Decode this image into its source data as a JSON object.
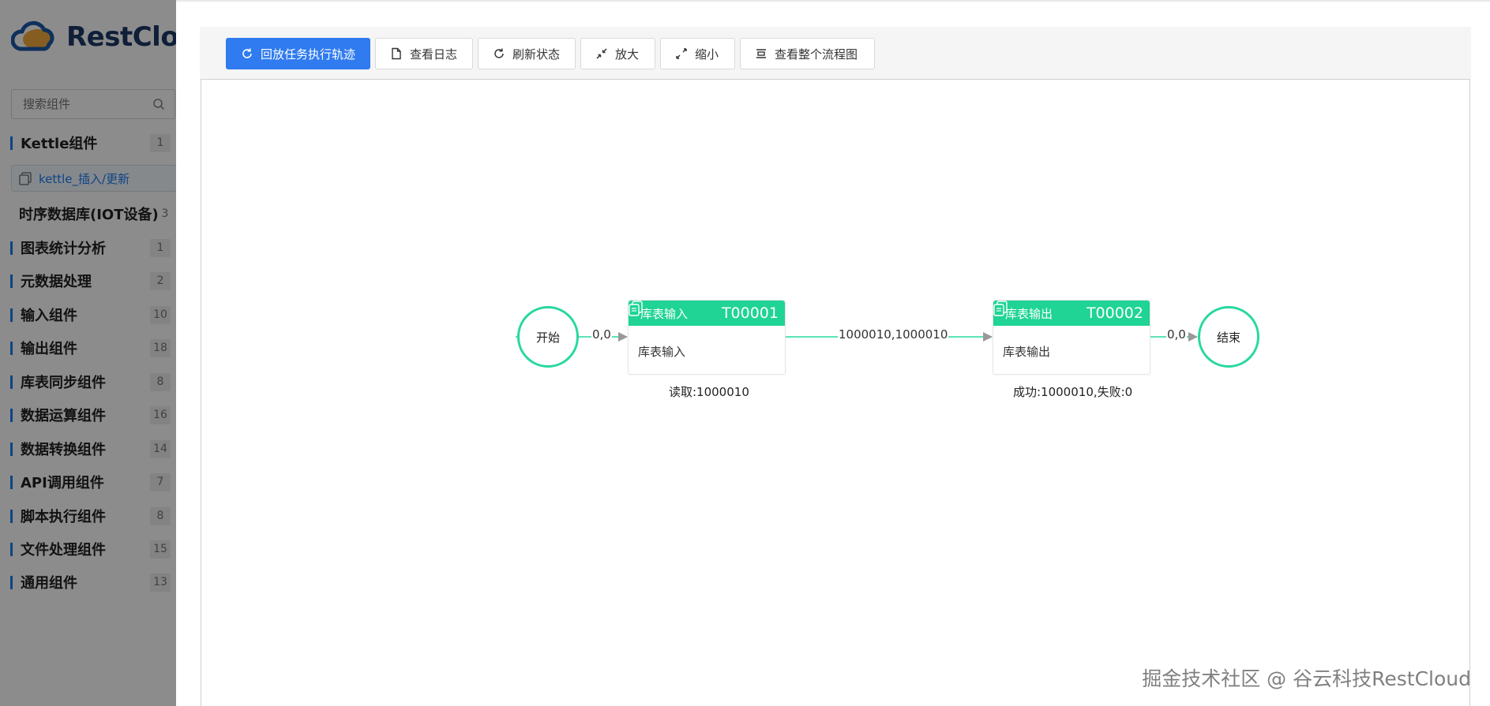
{
  "sidebar": {
    "brand": "RestCloud",
    "search_placeholder": "搜索组件",
    "categories": [
      {
        "label": "Kettle组件",
        "count": "1"
      },
      {
        "label": "时序数据库(IOT设备)",
        "count": "3"
      },
      {
        "label": "图表统计分析",
        "count": "1"
      },
      {
        "label": "元数据处理",
        "count": "2"
      },
      {
        "label": "输入组件",
        "count": "10"
      },
      {
        "label": "输出组件",
        "count": "18"
      },
      {
        "label": "库表同步组件",
        "count": "8"
      },
      {
        "label": "数据运算组件",
        "count": "16"
      },
      {
        "label": "数据转换组件",
        "count": "14"
      },
      {
        "label": "API调用组件",
        "count": "7"
      },
      {
        "label": "脚本执行组件",
        "count": "8"
      },
      {
        "label": "文件处理组件",
        "count": "15"
      },
      {
        "label": "通用组件",
        "count": "13"
      }
    ],
    "sub_item": "kettle_插入/更新"
  },
  "toolbar": {
    "replay": "回放任务执行轨迹",
    "view_log": "查看日志",
    "refresh": "刷新状态",
    "zoom_in": "放大",
    "zoom_out": "缩小",
    "view_all": "查看整个流程图"
  },
  "flow": {
    "start": "开始",
    "end": "结束",
    "node1": {
      "title": "库表输入",
      "id": "T00001",
      "body": "库表输入",
      "stat": "读取:1000010"
    },
    "node2": {
      "title": "库表输出",
      "id": "T00002",
      "body": "库表输出",
      "stat": "成功:1000010,失败:0"
    },
    "edge_start": "0,0",
    "edge_mid": "1000010,1000010",
    "edge_end": "0,0",
    "colors": {
      "node": "#1fd495",
      "edge": "#27d8a0",
      "arrow": "#999999"
    }
  },
  "watermark": "掘金技术社区 @ 谷云科技RestCloud"
}
